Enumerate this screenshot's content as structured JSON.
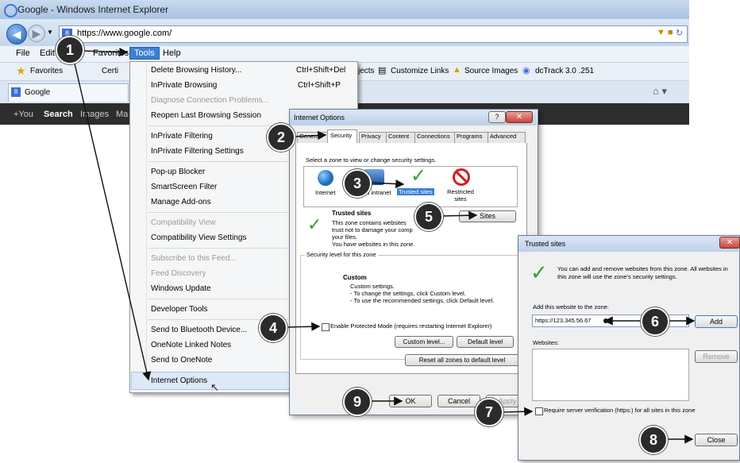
{
  "browser": {
    "title": "Google - Windows Internet Explorer",
    "address": "https://www.google.com/",
    "menu": [
      "File",
      "Edit",
      "Favorites",
      "Tools",
      "Help"
    ],
    "favorites_label": "Favorites",
    "links": [
      "Certi",
      "jects",
      "Customize Links",
      "Source Images",
      "dcTrack 3.0 .251"
    ],
    "tab_label": "Google",
    "google_bar": [
      "+You",
      "Search",
      "Images",
      "Ma"
    ]
  },
  "tools_menu": {
    "items": [
      {
        "label": "Delete Browsing History...",
        "shortcut": "Ctrl+Shift+Del",
        "disabled": false
      },
      {
        "label": "InPrivate Browsing",
        "shortcut": "Ctrl+Shift+P",
        "disabled": false
      },
      {
        "label": "Diagnose Connection Problems...",
        "shortcut": "",
        "disabled": true
      },
      {
        "label": "Reopen Last Browsing Session",
        "shortcut": "",
        "disabled": false
      },
      {
        "label": "InPrivate Filtering",
        "shortcut": "",
        "disabled": false
      },
      {
        "label": "InPrivate Filtering Settings",
        "shortcut": "",
        "disabled": false
      },
      {
        "label": "Pop-up Blocker",
        "shortcut": "",
        "disabled": false
      },
      {
        "label": "SmartScreen Filter",
        "shortcut": "",
        "disabled": false
      },
      {
        "label": "Manage Add-ons",
        "shortcut": "",
        "disabled": false
      },
      {
        "label": "Compatibility View",
        "shortcut": "",
        "disabled": true
      },
      {
        "label": "Compatibility View Settings",
        "shortcut": "",
        "disabled": false
      },
      {
        "label": "Subscribe to this Feed...",
        "shortcut": "",
        "disabled": true
      },
      {
        "label": "Feed Discovery",
        "shortcut": "",
        "disabled": true
      },
      {
        "label": "Windows Update",
        "shortcut": "",
        "disabled": false
      },
      {
        "label": "Developer Tools",
        "shortcut": "",
        "disabled": false
      },
      {
        "label": "Send to Bluetooth Device...",
        "shortcut": "",
        "disabled": false
      },
      {
        "label": "OneNote Linked Notes",
        "shortcut": "",
        "disabled": false
      },
      {
        "label": "Send to OneNote",
        "shortcut": "",
        "disabled": false
      },
      {
        "label": "Internet Options",
        "shortcut": "",
        "disabled": false
      }
    ]
  },
  "internet_options": {
    "title": "Internet Options",
    "tabs": [
      "General",
      "Security",
      "Privacy",
      "Content",
      "Connections",
      "Programs",
      "Advanced"
    ],
    "zone_prompt": "Select a zone to view or change security settings.",
    "zones": [
      "Internet",
      "Local intranet",
      "Trusted sites",
      "Restricted sites"
    ],
    "zone_heading": "Trusted sites",
    "zone_desc": [
      "This zone contains websites",
      "trust not to damage your comp",
      "your files.",
      "You have websites in this zone."
    ],
    "sites_button": "Sites",
    "security_level_label": "Security level for this zone",
    "custom_heading": "Custom",
    "custom_lines": [
      "Custom settings.",
      "- To change the settings, click Custom level.",
      "- To use the recommended settings, click Default level."
    ],
    "protected_mode": "Enable Protected Mode (requires restarting Internet Explorer)",
    "custom_level_button": "Custom level...",
    "default_level_button": "Default level",
    "reset_button": "Reset all zones to default level",
    "ok_button": "OK",
    "cancel_button": "Cancel",
    "apply_button": "Apply"
  },
  "trusted_sites": {
    "title": "Trusted sites",
    "info": [
      "You can add and remove websites from this zone. All websites in",
      "this zone will use the zone's security settings."
    ],
    "add_label": "Add this website to the zone:",
    "url_value": "https://123.345.56.67",
    "add_button": "Add",
    "websites_label": "Websites:",
    "remove_button": "Remove",
    "require_label": "Require server verification (https:) for all sites in this zone",
    "close_button": "Close"
  },
  "callouts": [
    "1",
    "2",
    "3",
    "4",
    "5",
    "6",
    "7",
    "8",
    "9"
  ]
}
